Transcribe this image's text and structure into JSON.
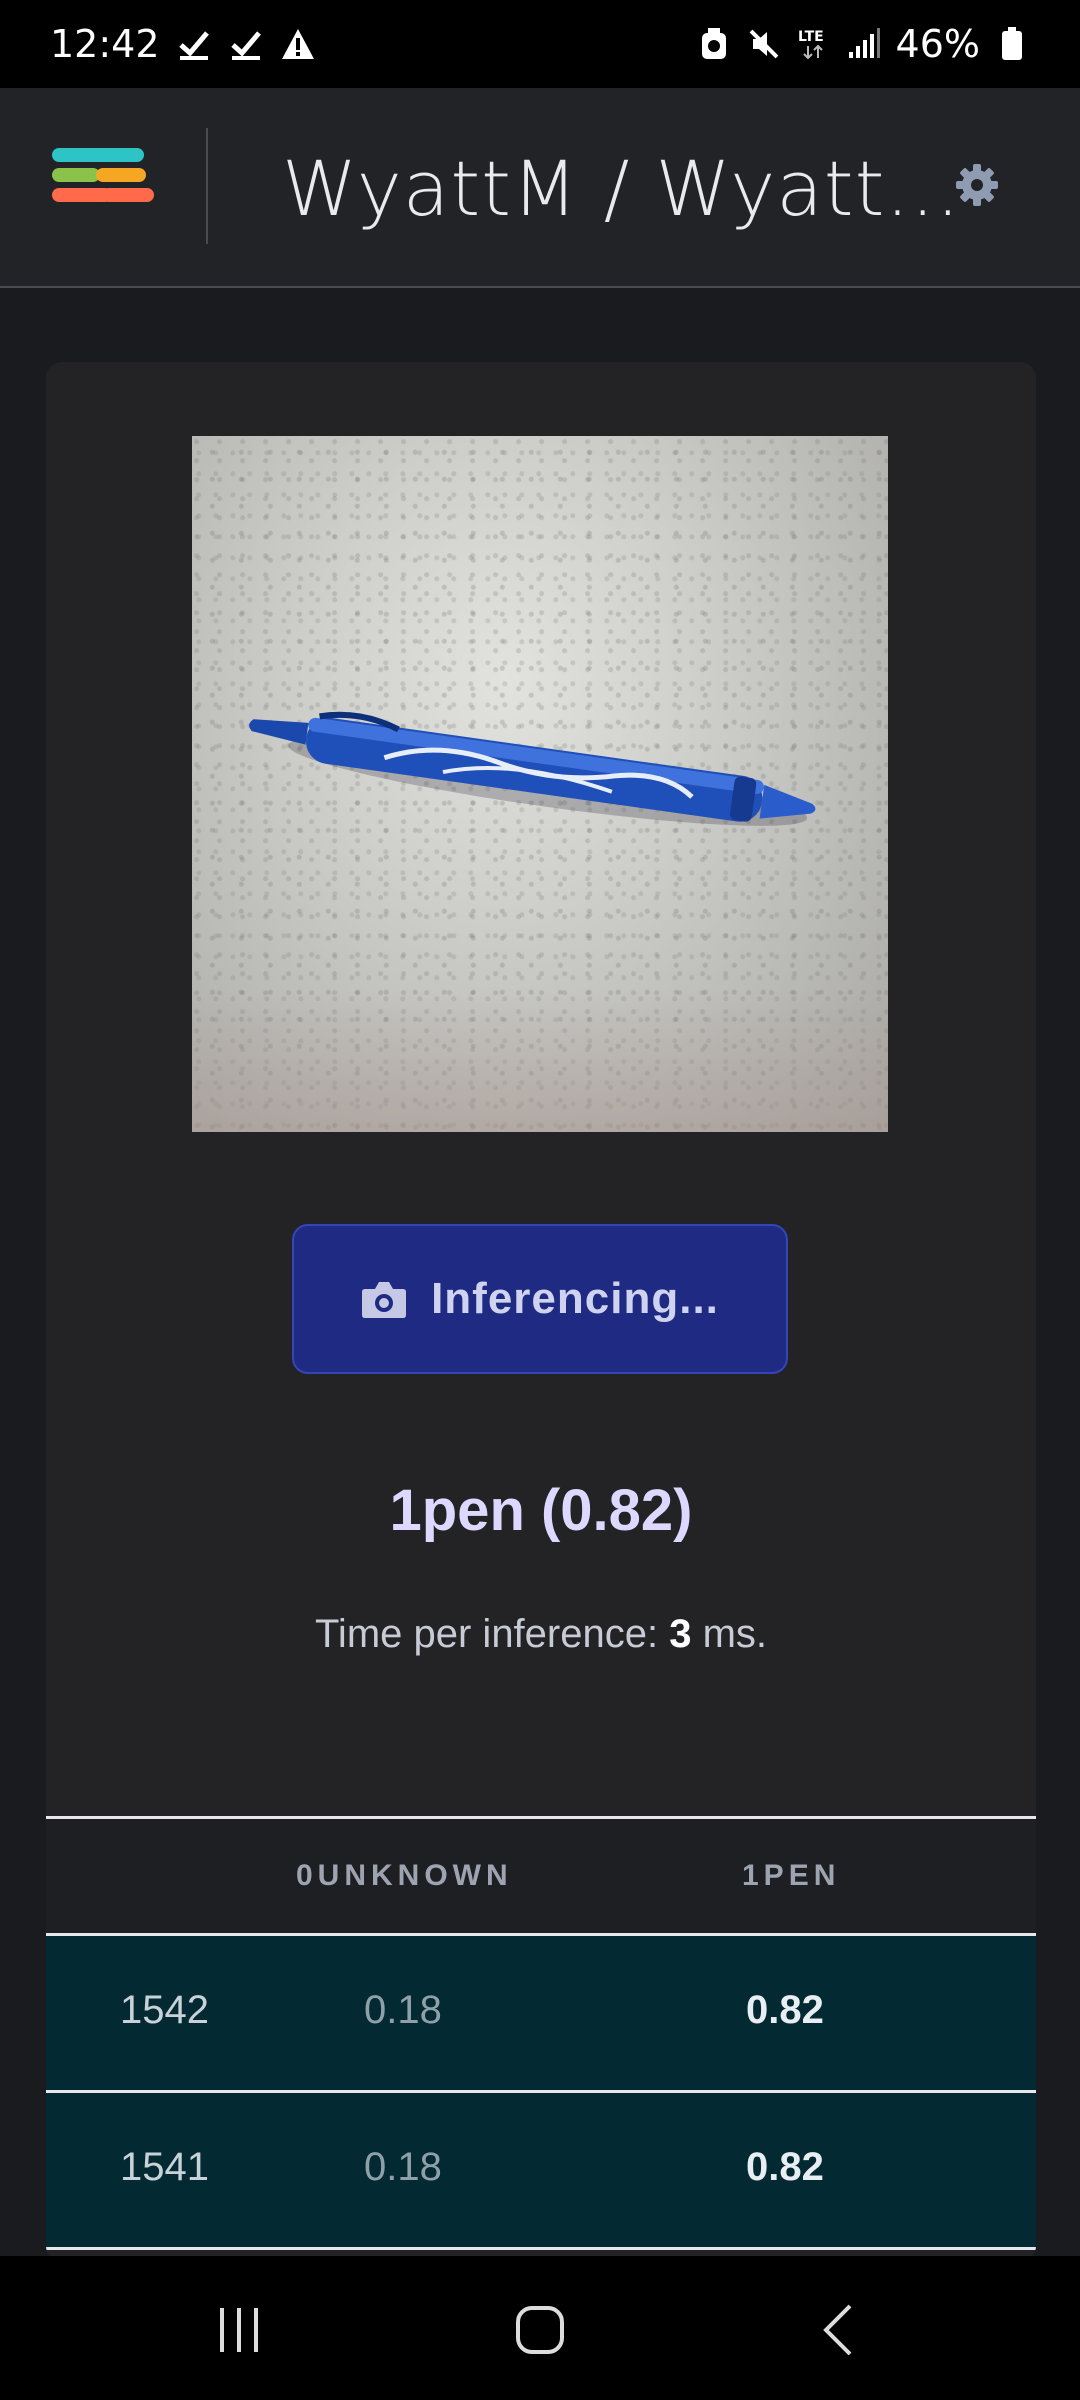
{
  "status_bar": {
    "time": "12:42",
    "battery": "46%",
    "network": "LTE",
    "icons": [
      "check-icon",
      "check-icon",
      "warning-icon",
      "alarm-icon",
      "mute-icon",
      "lte-icon",
      "signal-icon",
      "battery-icon"
    ]
  },
  "header": {
    "title": "WyattM / Wyatt...",
    "logo_colors": [
      "#2ec4c6",
      "#8bc34a",
      "#f5a623",
      "#ff6b4a"
    ]
  },
  "main": {
    "image": {
      "subject": "blue pen on gray countertop"
    },
    "infer_button": {
      "label": "Inferencing...",
      "icon": "camera-icon"
    },
    "prediction": "1pen (0.82)",
    "timing": {
      "prefix": "Time per inference: ",
      "value": "3",
      "suffix": " ms."
    },
    "table": {
      "columns": [
        "",
        "0UNKNOWN",
        "1PEN"
      ],
      "rows": [
        {
          "id": "1542",
          "unknown": "0.18",
          "pen": "0.82"
        },
        {
          "id": "1541",
          "unknown": "0.18",
          "pen": "0.82"
        }
      ]
    }
  },
  "nav_bar": {
    "icons": [
      "recents-icon",
      "home-icon",
      "back-icon"
    ]
  },
  "colors": {
    "accent_button": "#1f2a82",
    "table_row": "#032a33",
    "background": "#1a1b1e"
  }
}
